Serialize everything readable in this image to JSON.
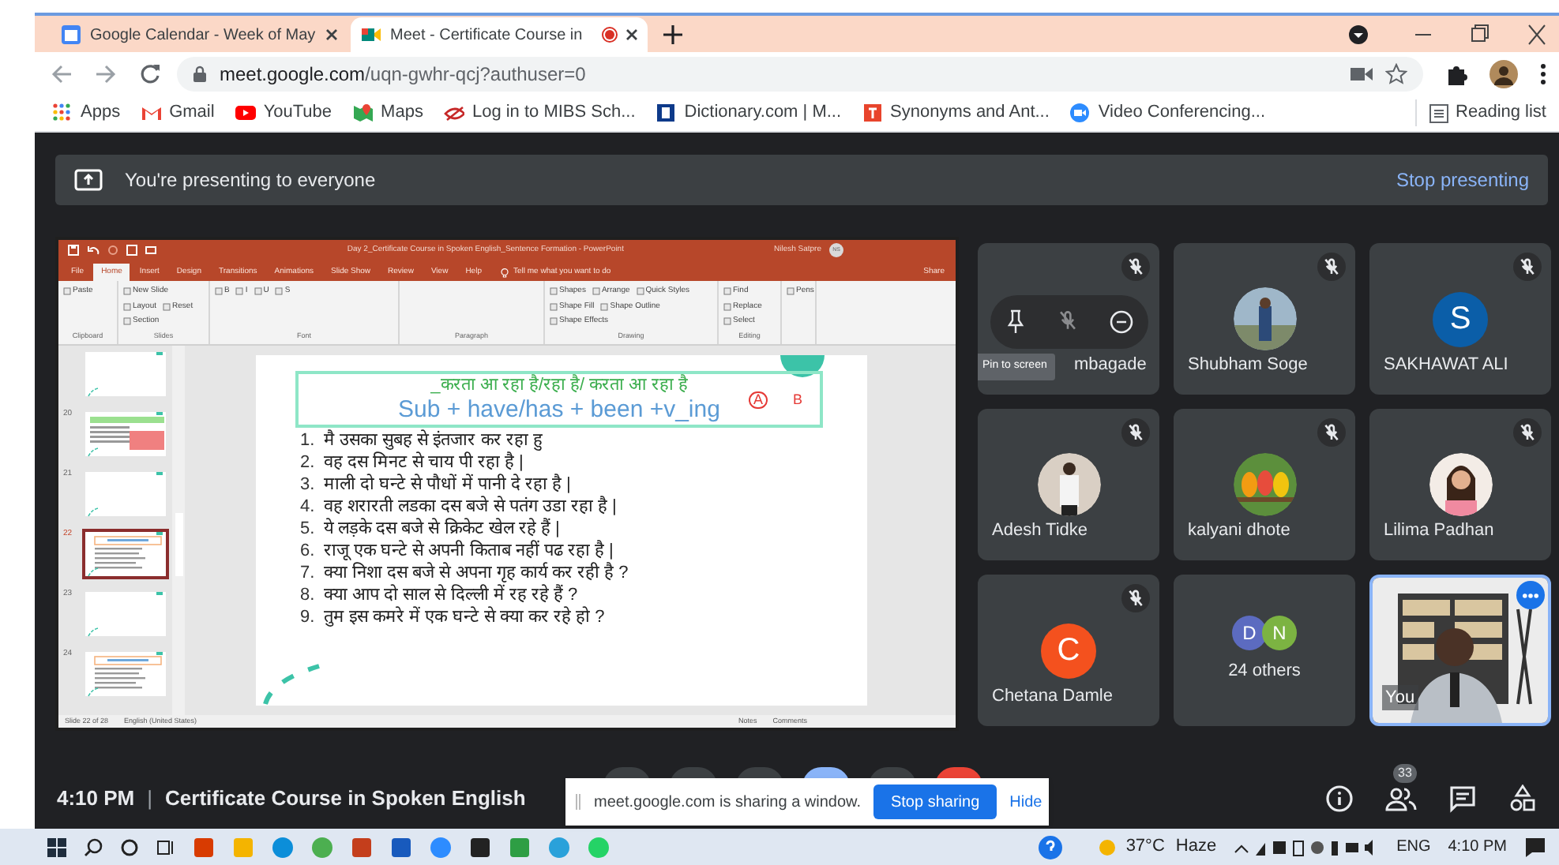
{
  "browser": {
    "tabs": [
      {
        "kind": "calendar",
        "title": "Google Calendar - Week of May",
        "recording": false,
        "selected": false
      },
      {
        "kind": "meet",
        "title": "Meet - Certificate Course in",
        "recording": true,
        "selected": true
      }
    ],
    "address": {
      "host": "meet.google.com",
      "path": "/uqn-gwhr-qcj?authuser=0"
    },
    "bookmarks": [
      {
        "kind": "apps",
        "label": "Apps"
      },
      {
        "kind": "gmail",
        "label": "Gmail"
      },
      {
        "kind": "youtube",
        "label": "YouTube"
      },
      {
        "kind": "maps",
        "label": "Maps"
      },
      {
        "kind": "mibs",
        "label": "Log in to MIBS Sch..."
      },
      {
        "kind": "dictionary",
        "label": "Dictionary.com | M..."
      },
      {
        "kind": "synonyms",
        "label": "Synonyms and Ant..."
      },
      {
        "kind": "zoom",
        "label": "Video Conferencing..."
      }
    ],
    "reading_list": "Reading list"
  },
  "meet": {
    "banner": {
      "text": "You're presenting to everyone",
      "action": "Stop presenting"
    },
    "powerpoint": {
      "title": "Day 2_Certificate Course in Spoken English_Sentence Formation - PowerPoint",
      "user": "Nilesh Satpre",
      "user_initials": "NS",
      "menu_tabs": [
        {
          "label": "File",
          "selected": false
        },
        {
          "label": "Home",
          "selected": true
        },
        {
          "label": "Insert",
          "selected": false
        },
        {
          "label": "Design",
          "selected": false
        },
        {
          "label": "Transitions",
          "selected": false
        },
        {
          "label": "Animations",
          "selected": false
        },
        {
          "label": "Slide Show",
          "selected": false
        },
        {
          "label": "Review",
          "selected": false
        },
        {
          "label": "View",
          "selected": false
        },
        {
          "label": "Help",
          "selected": false
        }
      ],
      "tell_me": "Tell me what you want to do",
      "share": "Share",
      "ribbon_groups": [
        {
          "name": "Clipboard",
          "commands": [
            "Paste"
          ]
        },
        {
          "name": "Slides",
          "commands": [
            "New Slide",
            "Layout",
            "Reset",
            "Section"
          ]
        },
        {
          "name": "Font",
          "commands": [
            "B",
            "I",
            "U",
            "S"
          ]
        },
        {
          "name": "Paragraph"
        },
        {
          "name": "Drawing",
          "commands": [
            "Shapes",
            "Arrange",
            "Quick Styles",
            "Shape Fill",
            "Shape Outline",
            "Shape Effects"
          ]
        },
        {
          "name": "Editing",
          "commands": [
            "Find",
            "Replace",
            "Select"
          ]
        },
        {
          "commands": [
            "Pens"
          ]
        }
      ],
      "thumbnails": [
        {
          "kind": "blank",
          "selected": false
        },
        {
          "number": "20",
          "kind": "dense",
          "selected": false
        },
        {
          "number": "21",
          "kind": "blank",
          "selected": false
        },
        {
          "number": "22",
          "kind": "list",
          "selected": true
        },
        {
          "number": "23",
          "kind": "blank",
          "selected": false
        },
        {
          "number": "24",
          "kind": "list",
          "selected": false
        }
      ],
      "status": {
        "slide": "Slide 22 of 28",
        "language": "English (United States)",
        "notes": "Notes",
        "comments": "Comments"
      },
      "slide": {
        "heading": "_करता आ रहा है/रहा है/ करता आ रहा है",
        "formula": "Sub + have/has + been +v_ing",
        "marks": [
          "A",
          "B"
        ],
        "sentences": [
          {
            "number": "1.",
            "text": "मै उसका सुबह से इंतजार कर रहा हु"
          },
          {
            "number": "2.",
            "text": "वह दस मिनट से चाय पी रहा है |"
          },
          {
            "number": "3.",
            "text": "माली दो घन्टे से पौधों में पानी दे रहा है |"
          },
          {
            "number": "4.",
            "text": "वह शरारती लडका दस बजे से पतंग उडा रहा है |"
          },
          {
            "number": "5.",
            "text": "ये लड़के दस बजे से क्रिकेट खेल रहे हैं |"
          },
          {
            "number": "6.",
            "text": "राजू एक घन्टे से अपनी किताब नहीं पढ रहा है |"
          },
          {
            "number": "7.",
            "text": "क्या निशा दस बजे से अपना गृह कार्य कर रही है ?"
          },
          {
            "number": "8.",
            "text": "क्या आप दो साल से दिल्ली में रह रहे हैं ?"
          },
          {
            "number": "9.",
            "text": "तुम इस कमरे में एक घन्टे से क्या कर रहे हो ?"
          }
        ]
      }
    },
    "participants": [
      {
        "kind": "hover",
        "name": "mbagade",
        "muted": true,
        "tooltip": "Pin to screen"
      },
      {
        "name": "Shubham Soge",
        "muted": true
      },
      {
        "kind": "letter",
        "name": "SAKHAWAT ALI",
        "initial": "S",
        "color": "#0b5ea8",
        "muted": true
      },
      {
        "name": "Adesh Tidke",
        "muted": true
      },
      {
        "name": "kalyani dhote",
        "muted": true
      },
      {
        "name": "Lilima Padhan",
        "muted": true
      },
      {
        "kind": "letter",
        "name": "Chetana Damle",
        "initial": "C",
        "color": "#f4511e",
        "muted": true
      },
      {
        "kind": "others",
        "label": "24 others",
        "muted": false,
        "avatars": [
          {
            "initial": "D",
            "color": "#5c6bc0"
          },
          {
            "initial": "N",
            "color": "#7cb342"
          }
        ]
      },
      {
        "kind": "self",
        "name": "You",
        "muted": false
      }
    ],
    "bottom_bar": {
      "time": "4:10 PM",
      "separator": "|",
      "title": "Certificate Course in Spoken English",
      "participant_count": "33"
    },
    "share_notice": {
      "text": "meet.google.com is sharing a window.",
      "stop": "Stop sharing",
      "hide": "Hide"
    }
  },
  "taskbar": {
    "apps": [
      {
        "kind": "office"
      },
      {
        "kind": "folder"
      },
      {
        "kind": "edge"
      },
      {
        "kind": "chrome"
      },
      {
        "kind": "powerpoint"
      },
      {
        "kind": "word"
      },
      {
        "kind": "zoom"
      },
      {
        "kind": "kapp"
      },
      {
        "kind": "happ"
      },
      {
        "kind": "telegram"
      },
      {
        "kind": "whatsapp"
      }
    ],
    "weather": "37°C",
    "condition": "Haze",
    "language": "ENG",
    "time": "4:10 PM"
  }
}
